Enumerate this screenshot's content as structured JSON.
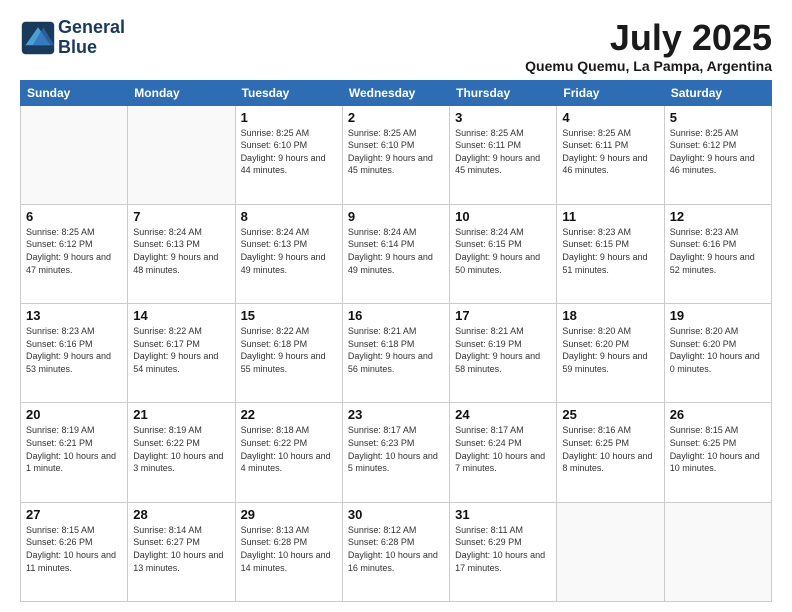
{
  "header": {
    "logo_line1": "General",
    "logo_line2": "Blue",
    "month_title": "July 2025",
    "subtitle": "Quemu Quemu, La Pampa, Argentina"
  },
  "weekdays": [
    "Sunday",
    "Monday",
    "Tuesday",
    "Wednesday",
    "Thursday",
    "Friday",
    "Saturday"
  ],
  "weeks": [
    [
      {
        "day": "",
        "info": ""
      },
      {
        "day": "",
        "info": ""
      },
      {
        "day": "1",
        "info": "Sunrise: 8:25 AM\nSunset: 6:10 PM\nDaylight: 9 hours and 44 minutes."
      },
      {
        "day": "2",
        "info": "Sunrise: 8:25 AM\nSunset: 6:10 PM\nDaylight: 9 hours and 45 minutes."
      },
      {
        "day": "3",
        "info": "Sunrise: 8:25 AM\nSunset: 6:11 PM\nDaylight: 9 hours and 45 minutes."
      },
      {
        "day": "4",
        "info": "Sunrise: 8:25 AM\nSunset: 6:11 PM\nDaylight: 9 hours and 46 minutes."
      },
      {
        "day": "5",
        "info": "Sunrise: 8:25 AM\nSunset: 6:12 PM\nDaylight: 9 hours and 46 minutes."
      }
    ],
    [
      {
        "day": "6",
        "info": "Sunrise: 8:25 AM\nSunset: 6:12 PM\nDaylight: 9 hours and 47 minutes."
      },
      {
        "day": "7",
        "info": "Sunrise: 8:24 AM\nSunset: 6:13 PM\nDaylight: 9 hours and 48 minutes."
      },
      {
        "day": "8",
        "info": "Sunrise: 8:24 AM\nSunset: 6:13 PM\nDaylight: 9 hours and 49 minutes."
      },
      {
        "day": "9",
        "info": "Sunrise: 8:24 AM\nSunset: 6:14 PM\nDaylight: 9 hours and 49 minutes."
      },
      {
        "day": "10",
        "info": "Sunrise: 8:24 AM\nSunset: 6:15 PM\nDaylight: 9 hours and 50 minutes."
      },
      {
        "day": "11",
        "info": "Sunrise: 8:23 AM\nSunset: 6:15 PM\nDaylight: 9 hours and 51 minutes."
      },
      {
        "day": "12",
        "info": "Sunrise: 8:23 AM\nSunset: 6:16 PM\nDaylight: 9 hours and 52 minutes."
      }
    ],
    [
      {
        "day": "13",
        "info": "Sunrise: 8:23 AM\nSunset: 6:16 PM\nDaylight: 9 hours and 53 minutes."
      },
      {
        "day": "14",
        "info": "Sunrise: 8:22 AM\nSunset: 6:17 PM\nDaylight: 9 hours and 54 minutes."
      },
      {
        "day": "15",
        "info": "Sunrise: 8:22 AM\nSunset: 6:18 PM\nDaylight: 9 hours and 55 minutes."
      },
      {
        "day": "16",
        "info": "Sunrise: 8:21 AM\nSunset: 6:18 PM\nDaylight: 9 hours and 56 minutes."
      },
      {
        "day": "17",
        "info": "Sunrise: 8:21 AM\nSunset: 6:19 PM\nDaylight: 9 hours and 58 minutes."
      },
      {
        "day": "18",
        "info": "Sunrise: 8:20 AM\nSunset: 6:20 PM\nDaylight: 9 hours and 59 minutes."
      },
      {
        "day": "19",
        "info": "Sunrise: 8:20 AM\nSunset: 6:20 PM\nDaylight: 10 hours and 0 minutes."
      }
    ],
    [
      {
        "day": "20",
        "info": "Sunrise: 8:19 AM\nSunset: 6:21 PM\nDaylight: 10 hours and 1 minute."
      },
      {
        "day": "21",
        "info": "Sunrise: 8:19 AM\nSunset: 6:22 PM\nDaylight: 10 hours and 3 minutes."
      },
      {
        "day": "22",
        "info": "Sunrise: 8:18 AM\nSunset: 6:22 PM\nDaylight: 10 hours and 4 minutes."
      },
      {
        "day": "23",
        "info": "Sunrise: 8:17 AM\nSunset: 6:23 PM\nDaylight: 10 hours and 5 minutes."
      },
      {
        "day": "24",
        "info": "Sunrise: 8:17 AM\nSunset: 6:24 PM\nDaylight: 10 hours and 7 minutes."
      },
      {
        "day": "25",
        "info": "Sunrise: 8:16 AM\nSunset: 6:25 PM\nDaylight: 10 hours and 8 minutes."
      },
      {
        "day": "26",
        "info": "Sunrise: 8:15 AM\nSunset: 6:25 PM\nDaylight: 10 hours and 10 minutes."
      }
    ],
    [
      {
        "day": "27",
        "info": "Sunrise: 8:15 AM\nSunset: 6:26 PM\nDaylight: 10 hours and 11 minutes."
      },
      {
        "day": "28",
        "info": "Sunrise: 8:14 AM\nSunset: 6:27 PM\nDaylight: 10 hours and 13 minutes."
      },
      {
        "day": "29",
        "info": "Sunrise: 8:13 AM\nSunset: 6:28 PM\nDaylight: 10 hours and 14 minutes."
      },
      {
        "day": "30",
        "info": "Sunrise: 8:12 AM\nSunset: 6:28 PM\nDaylight: 10 hours and 16 minutes."
      },
      {
        "day": "31",
        "info": "Sunrise: 8:11 AM\nSunset: 6:29 PM\nDaylight: 10 hours and 17 minutes."
      },
      {
        "day": "",
        "info": ""
      },
      {
        "day": "",
        "info": ""
      }
    ]
  ]
}
